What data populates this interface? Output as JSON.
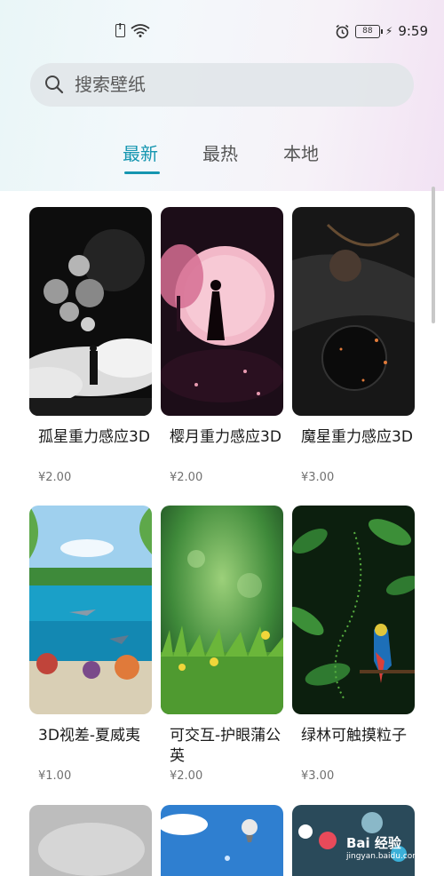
{
  "status_bar": {
    "battery": "88",
    "time": "9:59"
  },
  "search": {
    "placeholder": "搜索壁纸"
  },
  "tabs": [
    {
      "label": "最新",
      "active": true
    },
    {
      "label": "最热",
      "active": false
    },
    {
      "label": "本地",
      "active": false
    }
  ],
  "wallpapers": [
    {
      "title": "孤星重力感应3D",
      "price": "¥2.00"
    },
    {
      "title": "樱月重力感应3D",
      "price": "¥2.00"
    },
    {
      "title": "魔星重力感应3D",
      "price": "¥3.00"
    },
    {
      "title": "3D视差-夏威夷",
      "price": "¥1.00"
    },
    {
      "title": "可交互-护眼蒲公英",
      "price": "¥2.00"
    },
    {
      "title": "绿林可触摸粒子",
      "price": "¥3.00"
    }
  ],
  "watermark": {
    "brand": "Bai 经验",
    "url": "jingyan.baidu.com"
  },
  "colors": {
    "accent": "#1596b0"
  }
}
